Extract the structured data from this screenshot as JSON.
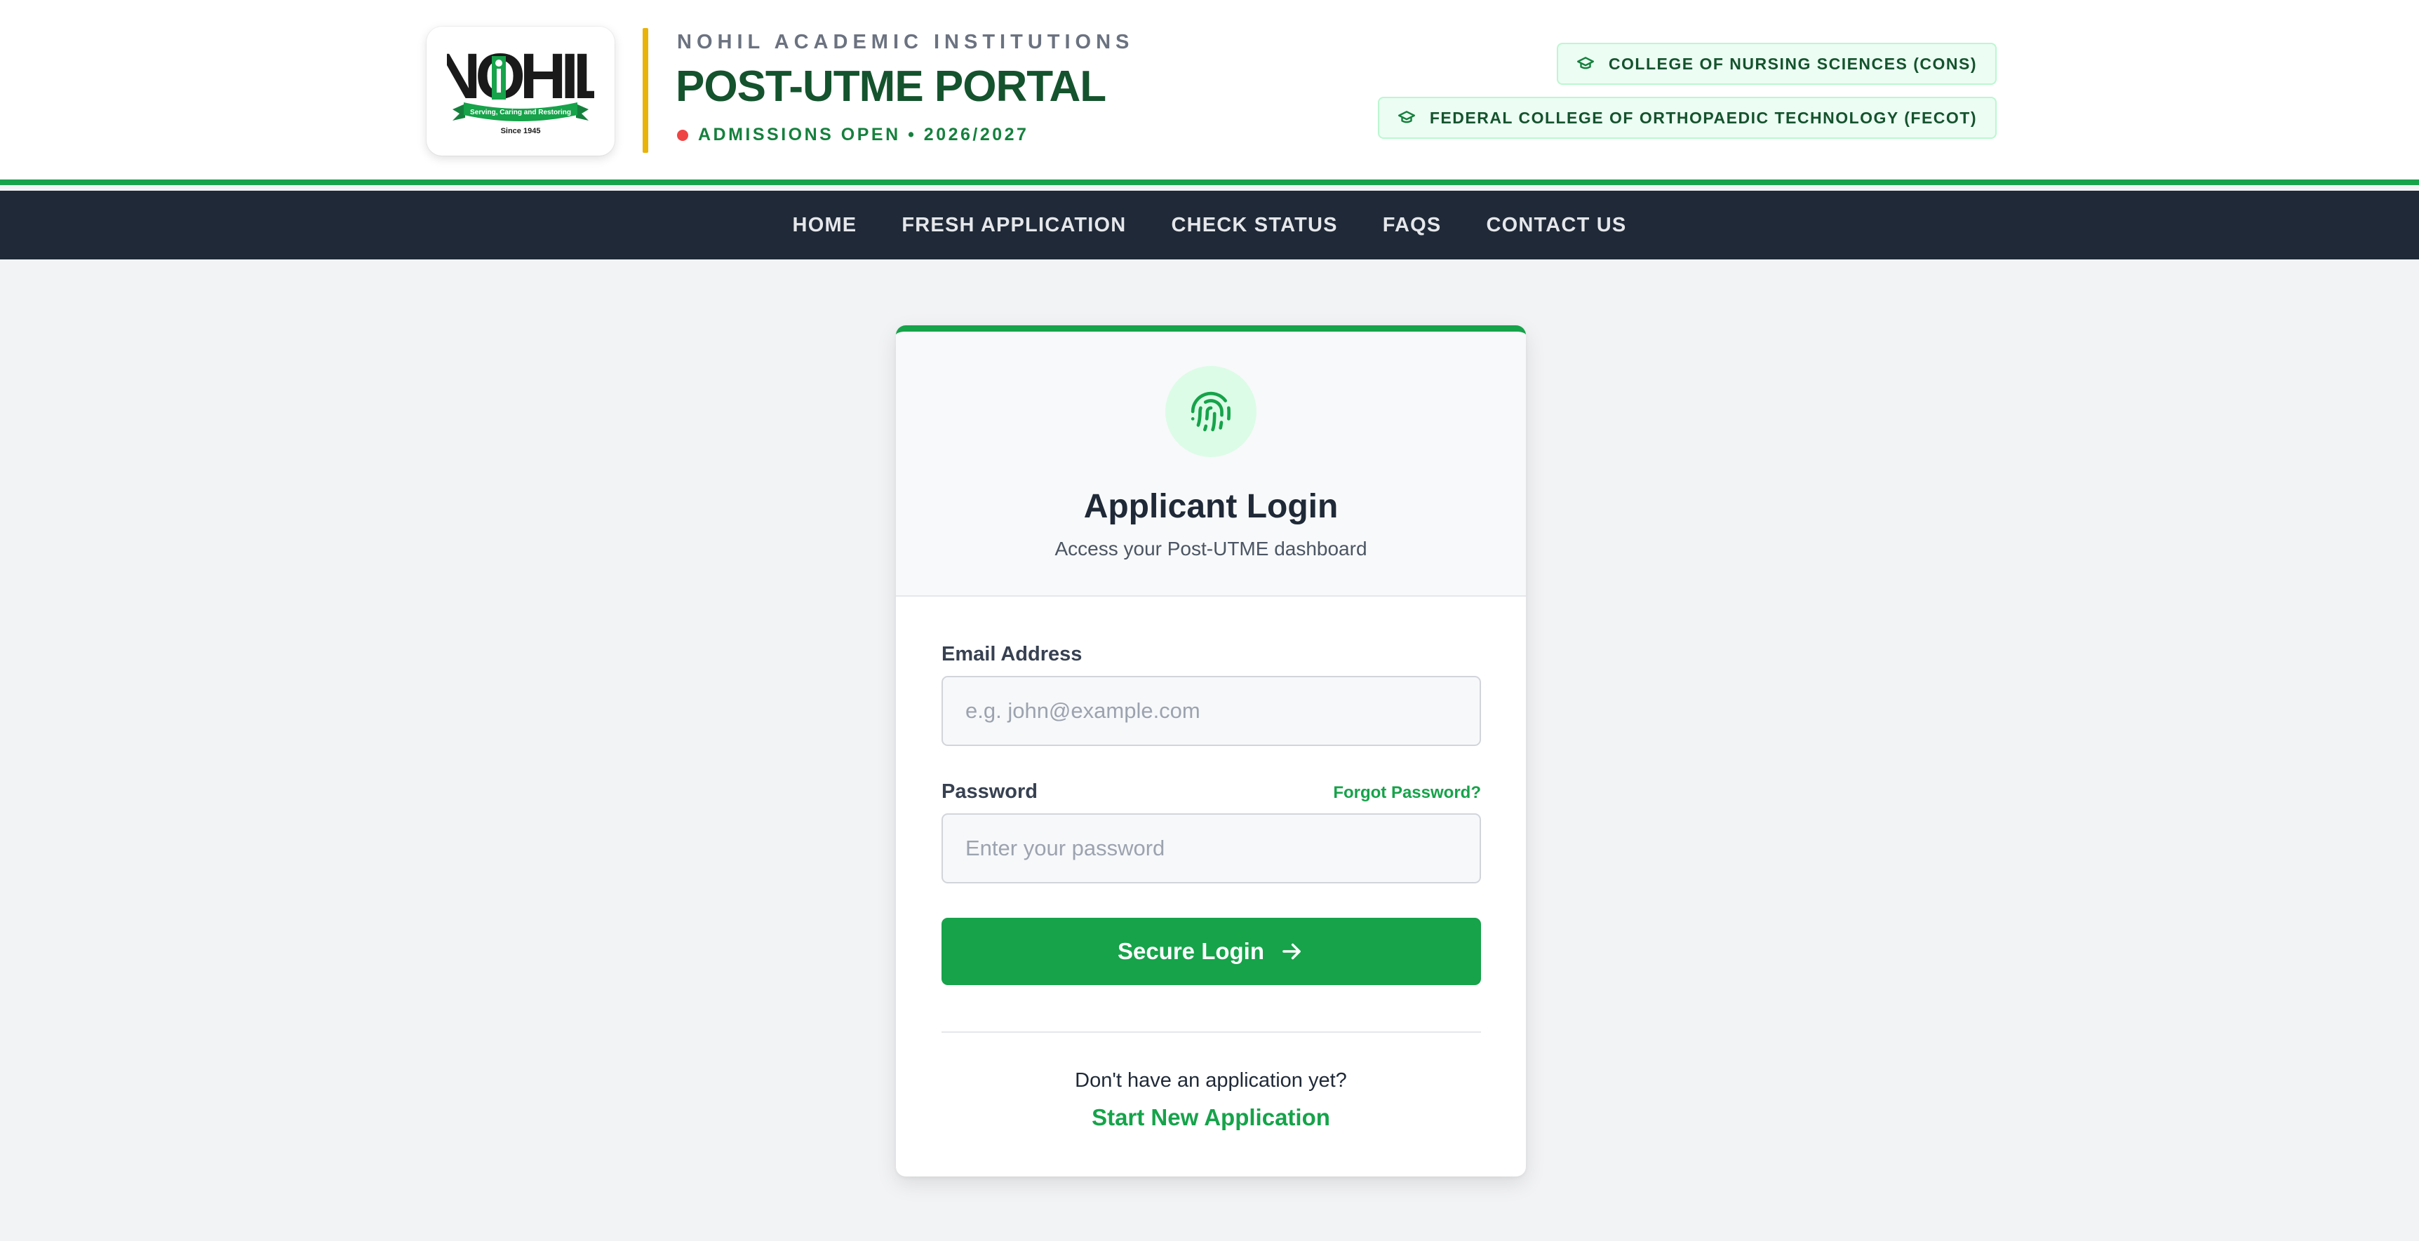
{
  "header": {
    "logo": {
      "alt": "NOHIL logo",
      "wordmark": "NOHIL",
      "ribbon": "Serving, Caring and Restoring",
      "since": "Since 1945"
    },
    "org_name": "NOHIL ACADEMIC INSTITUTIONS",
    "portal_title": "POST-UTME PORTAL",
    "admissions_status": "ADMISSIONS OPEN • 2026/2027",
    "badges": [
      {
        "icon": "graduation-cap-icon",
        "label": "COLLEGE OF NURSING SCIENCES (CONS)"
      },
      {
        "icon": "graduation-cap-icon",
        "label": "FEDERAL COLLEGE OF ORTHOPAEDIC TECHNOLOGY (FECOT)"
      }
    ]
  },
  "nav": {
    "items": [
      {
        "label": "HOME"
      },
      {
        "label": "FRESH APPLICATION"
      },
      {
        "label": "CHECK STATUS"
      },
      {
        "label": "FAQS"
      },
      {
        "label": "CONTACT US"
      }
    ]
  },
  "login": {
    "icon": "fingerprint-icon",
    "title": "Applicant Login",
    "subtitle": "Access your Post-UTME dashboard",
    "email": {
      "label": "Email Address",
      "placeholder": "e.g. john@example.com",
      "value": ""
    },
    "password": {
      "label": "Password",
      "placeholder": "Enter your password",
      "value": "",
      "forgot_label": "Forgot Password?"
    },
    "submit_label": "Secure Login",
    "submit_icon": "arrow-right-icon",
    "no_application_text": "Don't have an application yet?",
    "start_link_label": "Start New Application"
  },
  "colors": {
    "brand_green": "#16a34a",
    "dark_green": "#14532d",
    "nav_bg": "#1f2937",
    "accent_gold": "#eab308",
    "status_dot": "#ef4444"
  }
}
